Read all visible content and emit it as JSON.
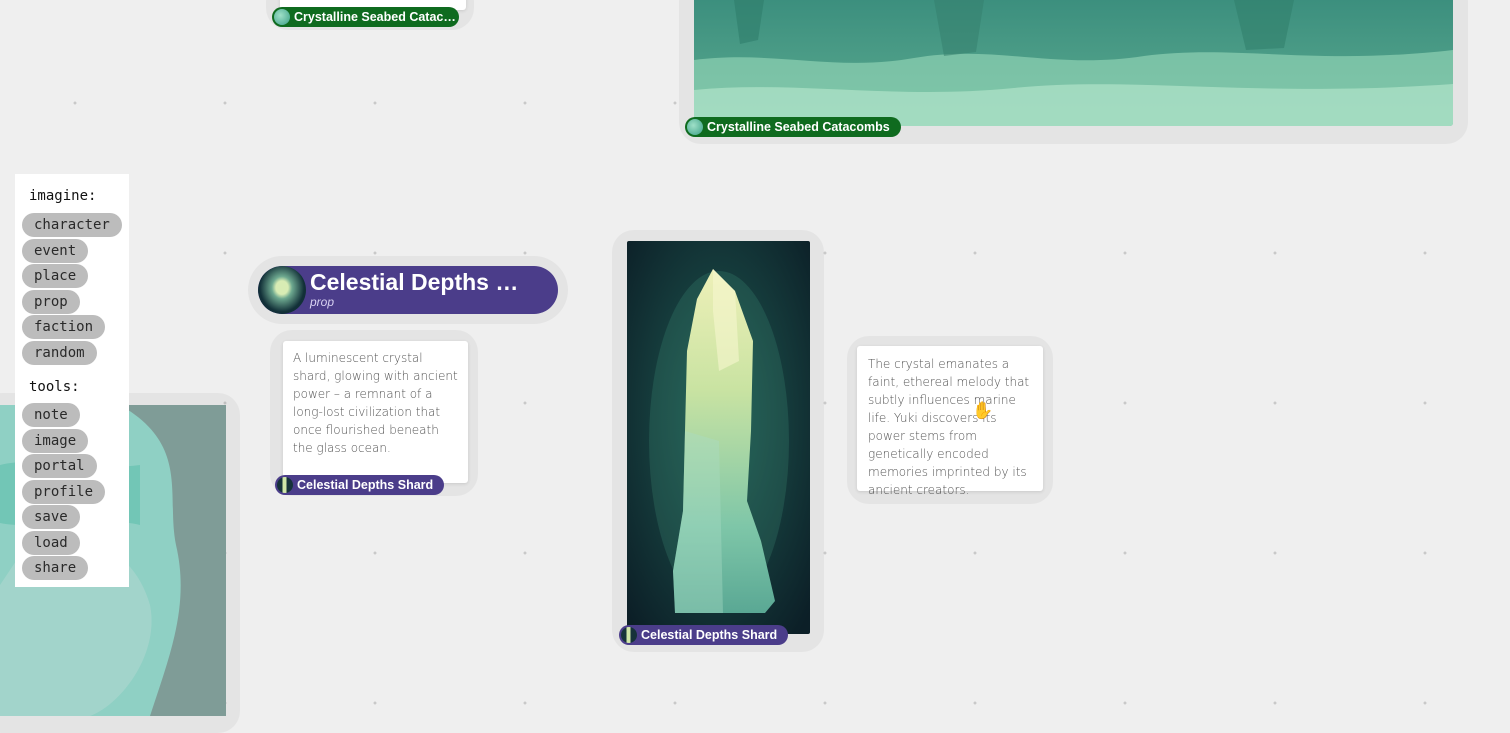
{
  "toolbar": {
    "imagine_label": "imagine:",
    "imagine_items": [
      "character",
      "event",
      "place",
      "prop",
      "faction",
      "random"
    ],
    "tools_label": "tools:",
    "tools_items": [
      "note",
      "image",
      "portal",
      "profile",
      "save",
      "load",
      "share"
    ]
  },
  "nodes": {
    "top_left_tag": "Crystalline Seabed Catac…",
    "top_right_tag": "Crystalline Seabed Catacombs",
    "header": {
      "title": "Celestial Depths …",
      "subtitle": "prop"
    },
    "note_left": {
      "text": "A luminescent crystal shard, glowing with ancient power – a remnant of a long-lost civilization that once flourished beneath the glass ocean.",
      "tag": "Celestial Depths Shard"
    },
    "image_center_tag": "Celestial Depths Shard",
    "note_right": {
      "text": "The crystal emanates a faint, ethereal melody that subtly influences marine life. Yuki discovers its power stems from genetically encoded memories imprinted by its ancient creators."
    }
  },
  "colors": {
    "background": "#efefef",
    "place_tag": "#0f6b1f",
    "prop_tag": "#4b3d8a",
    "pill": "#bcbcbc"
  },
  "icons": {
    "cursor": "grab-hand-icon"
  }
}
